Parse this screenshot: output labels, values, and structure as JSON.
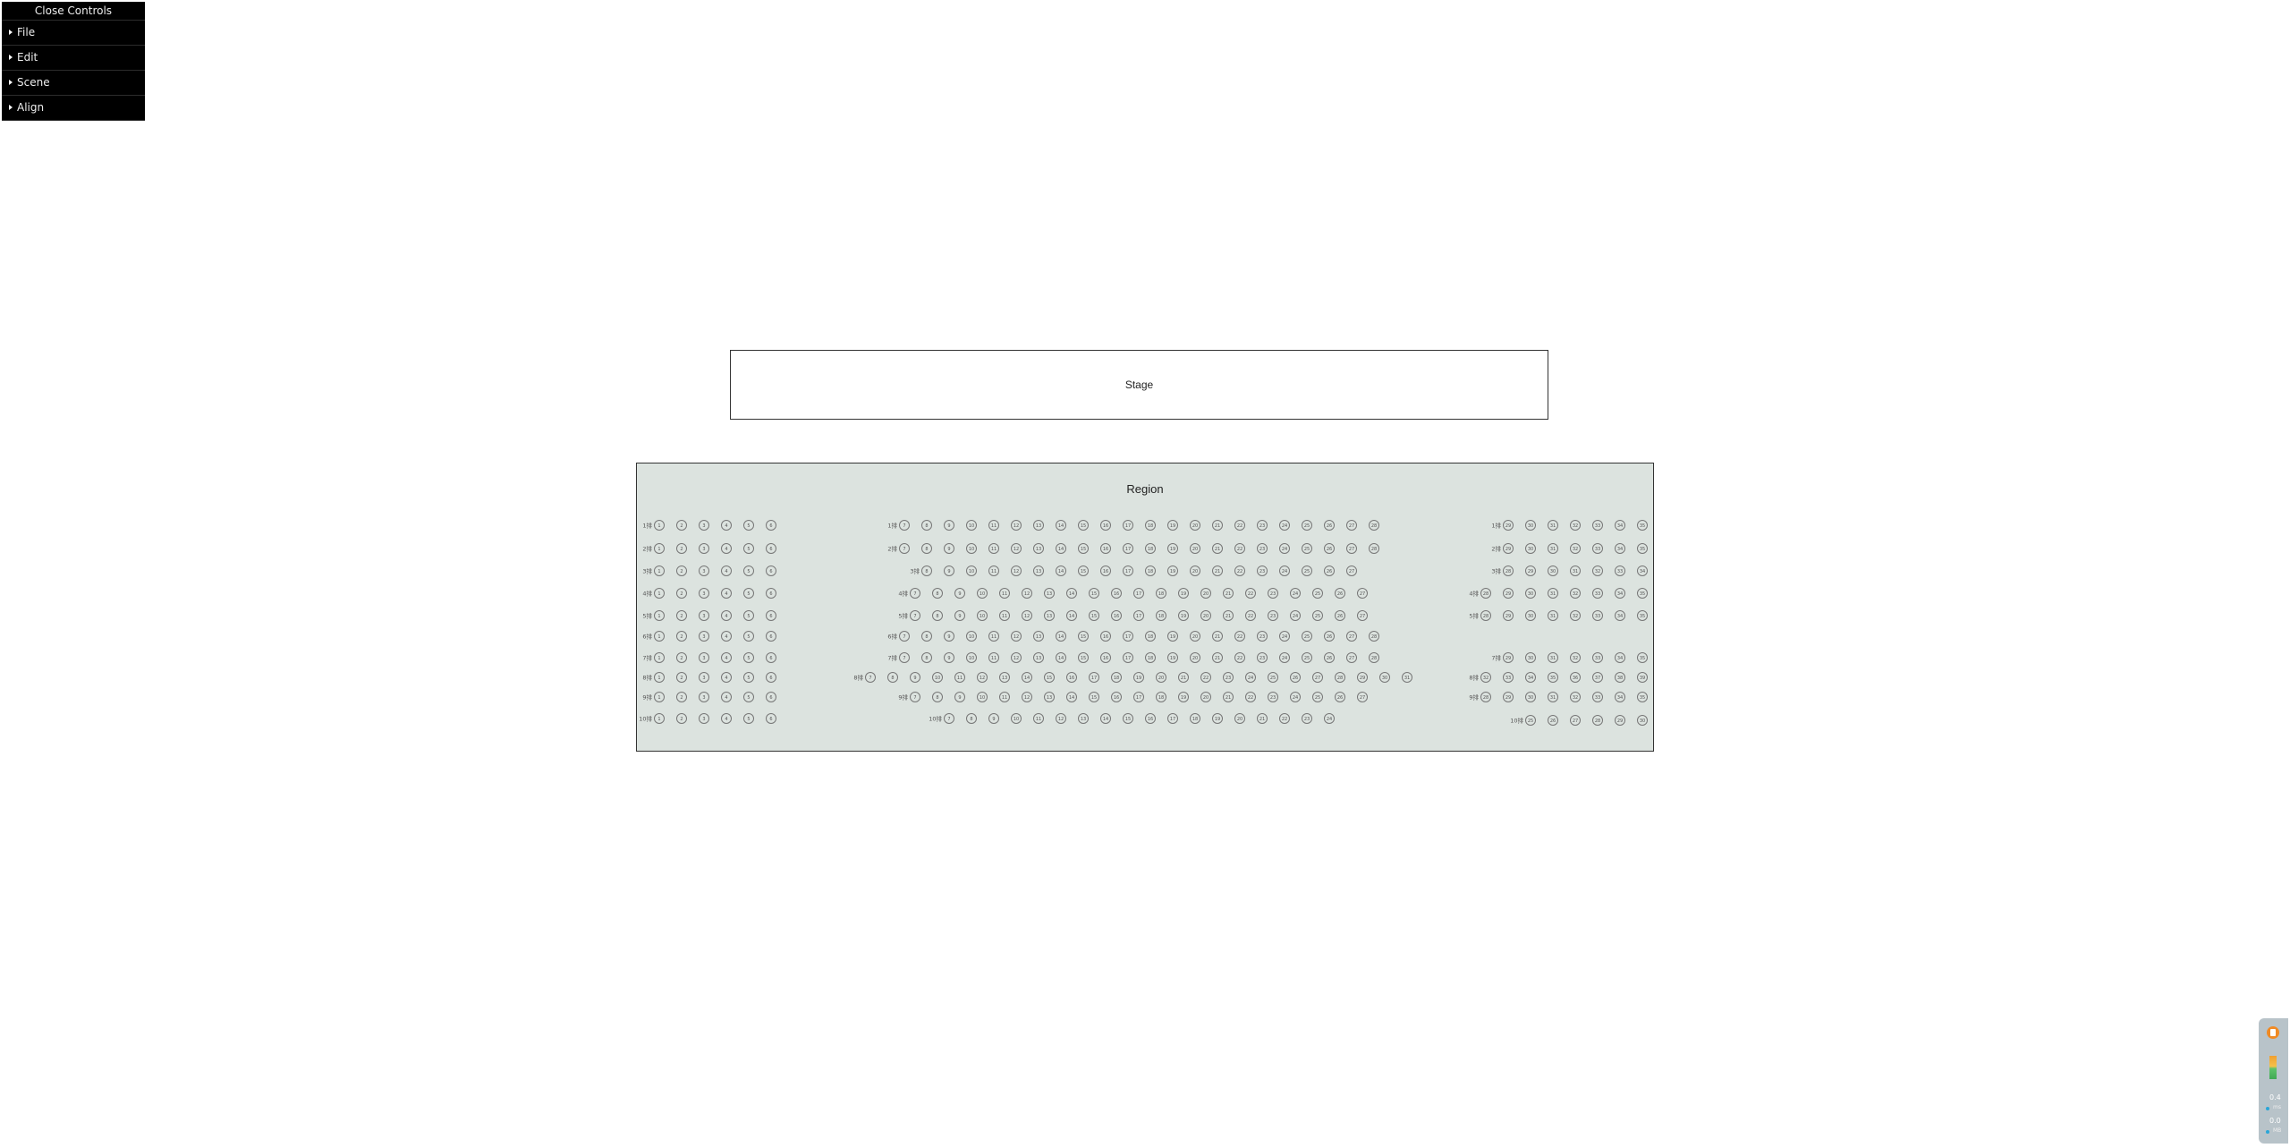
{
  "gui": {
    "close_label": "Close Controls",
    "folders": [
      "File",
      "Edit",
      "Scene",
      "Align"
    ]
  },
  "stage": {
    "label": "Stage"
  },
  "region": {
    "title": "Region",
    "background": "#dce3df",
    "blocks": [
      {
        "name": "left",
        "rows": [
          {
            "label": "1排",
            "seats": [
              "1",
              "2",
              "3",
              "4",
              "5",
              "6"
            ]
          },
          {
            "label": "2排",
            "seats": [
              "1",
              "2",
              "3",
              "4",
              "5",
              "6"
            ]
          },
          {
            "label": "3排",
            "seats": [
              "1",
              "2",
              "3",
              "4",
              "5",
              "6"
            ]
          },
          {
            "label": "4排",
            "seats": [
              "1",
              "2",
              "3",
              "4",
              "5",
              "6"
            ]
          },
          {
            "label": "5排",
            "seats": [
              "1",
              "2",
              "3",
              "4",
              "5",
              "6"
            ]
          },
          {
            "label": "6排",
            "seats": [
              "1",
              "2",
              "3",
              "4",
              "5",
              "6"
            ]
          },
          {
            "label": "7排",
            "seats": [
              "1",
              "2",
              "3",
              "4",
              "5",
              "6"
            ]
          },
          {
            "label": "8排",
            "seats": [
              "1",
              "2",
              "3",
              "4",
              "5",
              "6"
            ]
          },
          {
            "label": "9排",
            "seats": [
              "1",
              "2",
              "3",
              "4",
              "5",
              "6"
            ]
          },
          {
            "label": "10排",
            "seats": [
              "1",
              "2",
              "3",
              "4",
              "5",
              "6"
            ]
          }
        ]
      },
      {
        "name": "center",
        "rows": [
          {
            "label": "1排",
            "seats": [
              "7",
              "8",
              "9",
              "10",
              "11",
              "12",
              "13",
              "14",
              "15",
              "16",
              "17",
              "18",
              "19",
              "20",
              "21",
              "22",
              "23",
              "24",
              "25",
              "26",
              "27",
              "28"
            ]
          },
          {
            "label": "2排",
            "seats": [
              "7",
              "8",
              "9",
              "10",
              "11",
              "12",
              "13",
              "14",
              "15",
              "16",
              "17",
              "18",
              "19",
              "20",
              "21",
              "22",
              "23",
              "24",
              "25",
              "26",
              "27",
              "28"
            ]
          },
          {
            "label": "3排",
            "seats": [
              "8",
              "9",
              "10",
              "11",
              "12",
              "13",
              "14",
              "15",
              "16",
              "17",
              "18",
              "19",
              "20",
              "21",
              "22",
              "23",
              "24",
              "25",
              "26",
              "27"
            ]
          },
          {
            "label": "4排",
            "seats": [
              "7",
              "8",
              "9",
              "10",
              "11",
              "12",
              "13",
              "14",
              "15",
              "16",
              "17",
              "18",
              "19",
              "20",
              "21",
              "22",
              "23",
              "24",
              "25",
              "26",
              "27"
            ]
          },
          {
            "label": "5排",
            "seats": [
              "7",
              "8",
              "9",
              "10",
              "11",
              "12",
              "13",
              "14",
              "15",
              "16",
              "17",
              "18",
              "19",
              "20",
              "21",
              "22",
              "23",
              "24",
              "25",
              "26",
              "27"
            ]
          },
          {
            "label": "6排",
            "seats": [
              "7",
              "8",
              "9",
              "10",
              "11",
              "12",
              "13",
              "14",
              "15",
              "16",
              "17",
              "18",
              "19",
              "20",
              "21",
              "22",
              "23",
              "24",
              "25",
              "26",
              "27",
              "28"
            ]
          },
          {
            "label": "7排",
            "seats": [
              "7",
              "8",
              "9",
              "10",
              "11",
              "12",
              "13",
              "14",
              "15",
              "16",
              "17",
              "18",
              "19",
              "20",
              "21",
              "22",
              "23",
              "24",
              "25",
              "26",
              "27",
              "28"
            ]
          },
          {
            "label": "8排",
            "seats": [
              "7",
              "8",
              "9",
              "10",
              "11",
              "12",
              "13",
              "14",
              "15",
              "16",
              "17",
              "18",
              "19",
              "20",
              "21",
              "22",
              "23",
              "24",
              "25",
              "26",
              "27",
              "28",
              "29",
              "30",
              "31"
            ]
          },
          {
            "label": "9排",
            "seats": [
              "7",
              "8",
              "9",
              "10",
              "11",
              "12",
              "13",
              "14",
              "15",
              "16",
              "17",
              "18",
              "19",
              "20",
              "21",
              "22",
              "23",
              "24",
              "25",
              "26",
              "27"
            ]
          },
          {
            "label": "10排",
            "seats": [
              "7",
              "8",
              "9",
              "10",
              "11",
              "12",
              "13",
              "14",
              "15",
              "16",
              "17",
              "18",
              "19",
              "20",
              "21",
              "22",
              "23",
              "24"
            ]
          }
        ]
      },
      {
        "name": "right",
        "rows": [
          {
            "label": "1排",
            "seats": [
              "29",
              "30",
              "31",
              "32",
              "33",
              "34",
              "35"
            ]
          },
          {
            "label": "2排",
            "seats": [
              "29",
              "30",
              "31",
              "32",
              "33",
              "34",
              "35"
            ]
          },
          {
            "label": "3排",
            "seats": [
              "28",
              "29",
              "30",
              "31",
              "32",
              "33",
              "34"
            ]
          },
          {
            "label": "4排",
            "seats": [
              "28",
              "29",
              "30",
              "31",
              "32",
              "33",
              "34",
              "35"
            ]
          },
          {
            "label": "5排",
            "seats": [
              "28",
              "29",
              "30",
              "31",
              "32",
              "33",
              "34",
              "35"
            ]
          },
          {
            "label": "7排",
            "seats": [
              "29",
              "30",
              "31",
              "32",
              "33",
              "34",
              "35"
            ]
          },
          {
            "label": "8排",
            "seats": [
              "32",
              "33",
              "34",
              "35",
              "36",
              "37",
              "38",
              "39"
            ]
          },
          {
            "label": "9排",
            "seats": [
              "28",
              "29",
              "30",
              "31",
              "32",
              "33",
              "34",
              "35"
            ]
          },
          {
            "label": "10排",
            "seats": [
              "25",
              "26",
              "27",
              "28",
              "29",
              "30"
            ]
          }
        ]
      }
    ]
  },
  "stats": {
    "value1": "0.4",
    "unit1": "ms",
    "value2": "0.0",
    "unit2": "MB"
  }
}
